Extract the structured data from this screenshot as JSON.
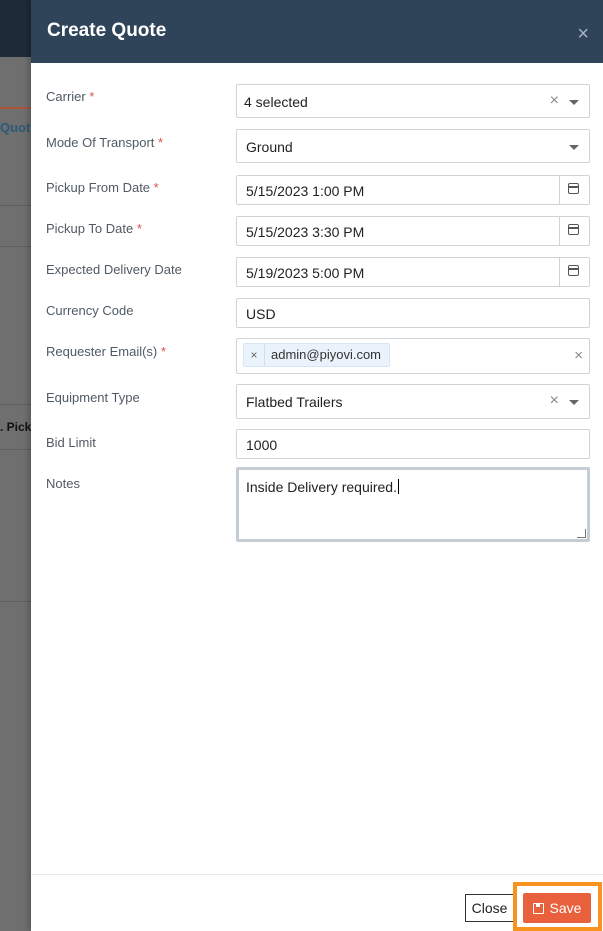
{
  "background": {
    "tab_text": "Quot",
    "column_text": ". Pick"
  },
  "modal": {
    "title": "Create Quote",
    "close_symbol": "×"
  },
  "form": {
    "carrier": {
      "label": "Carrier",
      "required": "*",
      "value": "4 selected"
    },
    "mode": {
      "label": "Mode Of Transport",
      "required": "*",
      "value": "Ground"
    },
    "pickup_from": {
      "label": "Pickup From Date",
      "required": "*",
      "value": "5/15/2023 1:00 PM"
    },
    "pickup_to": {
      "label": "Pickup To Date",
      "required": "*",
      "value": "5/15/2023 3:30 PM"
    },
    "expected_delivery": {
      "label": "Expected Delivery Date",
      "value": "5/19/2023 5:00 PM"
    },
    "currency": {
      "label": "Currency Code",
      "value": "USD"
    },
    "requester": {
      "label": "Requester Email(s)",
      "required": "*",
      "chip": "admin@piyovi.com"
    },
    "equipment": {
      "label": "Equipment Type",
      "value": "Flatbed Trailers"
    },
    "bid_limit": {
      "label": "Bid Limit",
      "value": "1000"
    },
    "notes": {
      "label": "Notes",
      "value": "Inside Delivery required."
    }
  },
  "footer": {
    "close_label": "Close",
    "save_label": "Save"
  },
  "colors": {
    "header": "#2f4458",
    "save": "#e8603c",
    "highlight": "#f7931e"
  }
}
